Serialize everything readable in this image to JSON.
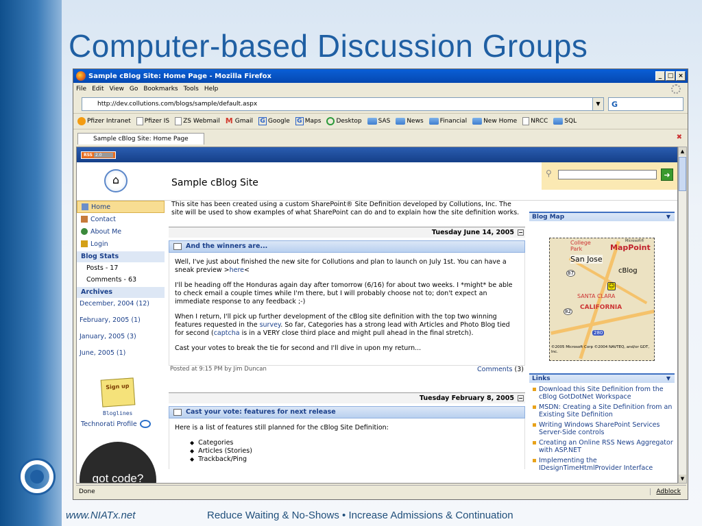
{
  "slide": {
    "title": "Computer-based Discussion Groups",
    "footer_left": "www.NIATx.net",
    "footer_right": "Reduce Waiting & No-Shows • Increase Admissions & Continuation"
  },
  "browser": {
    "window_title": "Sample cBlog Site: Home Page - Mozilla Firefox",
    "window_buttons": [
      "_",
      "□",
      "×"
    ],
    "menu": [
      "File",
      "Edit",
      "View",
      "Go",
      "Bookmarks",
      "Tools",
      "Help"
    ],
    "url": "http://dev.collutions.com/blogs/sample/default.aspx",
    "bookmarks": [
      {
        "label": "Pfizer Intranet",
        "icon": "pfizer-icon"
      },
      {
        "label": "Pfizer IS",
        "icon": "page-icon"
      },
      {
        "label": "ZS Webmail",
        "icon": "page-icon"
      },
      {
        "label": "Gmail",
        "icon": "gmail-icon"
      },
      {
        "label": "Google",
        "icon": "google-icon"
      },
      {
        "label": "Maps",
        "icon": "google-icon"
      },
      {
        "label": "Desktop",
        "icon": "desktop-icon"
      },
      {
        "label": "SAS",
        "icon": "folder-icon"
      },
      {
        "label": "News",
        "icon": "folder-icon"
      },
      {
        "label": "Financial",
        "icon": "folder-icon"
      },
      {
        "label": "New Home",
        "icon": "folder-icon"
      },
      {
        "label": "NRCC",
        "icon": "page-icon"
      },
      {
        "label": "SQL",
        "icon": "folder-icon"
      }
    ],
    "tab_label": "Sample cBlog Site: Home Page",
    "status_text": "Done",
    "adblock_label": "Adblock"
  },
  "page": {
    "rss_label": "RSS",
    "rss_version": "2.0",
    "site_title": "Sample cBlog Site",
    "nav": {
      "home": "Home",
      "contact": "Contact",
      "about": "About Me",
      "login": "Login",
      "blog_stats_label": "Blog Stats",
      "posts": "Posts - 17",
      "comments": "Comments - 63",
      "archives_label": "Archives",
      "archives": [
        "December, 2004 (12)",
        "February, 2005 (1)",
        "January, 2005 (3)",
        "June, 2005 (1)"
      ],
      "bloglines": "Bloglines",
      "bloglines_badge": "Sign up",
      "technorati": "Technorati Profile",
      "gotcode": "got code?"
    },
    "intro": "This site has been created using a custom SharePoint® Site Definition developed by Collutions, Inc. The site will be used to show examples of what SharePoint can do and to explain how the site definition works.",
    "posts": [
      {
        "date": "Tuesday June 14, 2005",
        "title": "And the winners are...",
        "p1_pre": "Well, I've just about finished the new site for Collutions and plan to launch on July 1st. You can have a sneak preview >",
        "p1_link": "here",
        "p1_post": "<",
        "p2": "I'll be heading off the Honduras again day after tomorrow (6/16) for about two weeks. I *might* be able to check email a couple times while I'm there, but I will probably choose not to; don't expect an immediate response to any feedback ;-)",
        "p3_a": "When I return, I'll pick up further development of the cBlog site definition with the top two winning features requested in the ",
        "p3_link1": "survey",
        "p3_b": ". So far, Categories has a strong lead with Articles and Photo Blog tied for second (",
        "p3_link2": "captcha",
        "p3_c": " is in a VERY close third place and might pull ahead in the final stretch).",
        "p4": "Cast your votes to break the tie for second and I'll dive in upon my return...",
        "posted": "Posted at 9:15 PM by Jim Duncan",
        "comments_label": "Comments",
        "comments_count": "(3)"
      },
      {
        "date": "Tuesday February 8, 2005",
        "title": "Cast your vote: features for next release",
        "p1": "Here is a list of features still planned for the cBlog Site Definition:",
        "features": [
          "Categories",
          "Articles (Stories)",
          "Trackback/Ping"
        ]
      }
    ],
    "blog_map_label": "Blog Map",
    "map": {
      "college_park": "College Park",
      "mappoint": "MapPoint",
      "microsoft": "Microsoft®",
      "san_jose": "San Jose",
      "cblog": "cBlog",
      "santa_clara": "SANTA CLARA",
      "california": "CALIFORNIA",
      "route_87": "87",
      "route_82": "82",
      "route_280": "280",
      "copyright": "©2005 Microsoft Corp ©2004 NAVTEQ, and/or GDT, Inc."
    },
    "links_label": "Links",
    "links": [
      "Download this Site Definition from the cBlog GotDotNet Workspace",
      "MSDN: Creating a Site Definition from an Existing Site Definition",
      "Writing Windows SharePoint Services Server-Side controls",
      "Creating an Online RSS News Aggregator with ASP.NET",
      "Implementing the IDesignTimeHtmlProvider Interface"
    ]
  }
}
